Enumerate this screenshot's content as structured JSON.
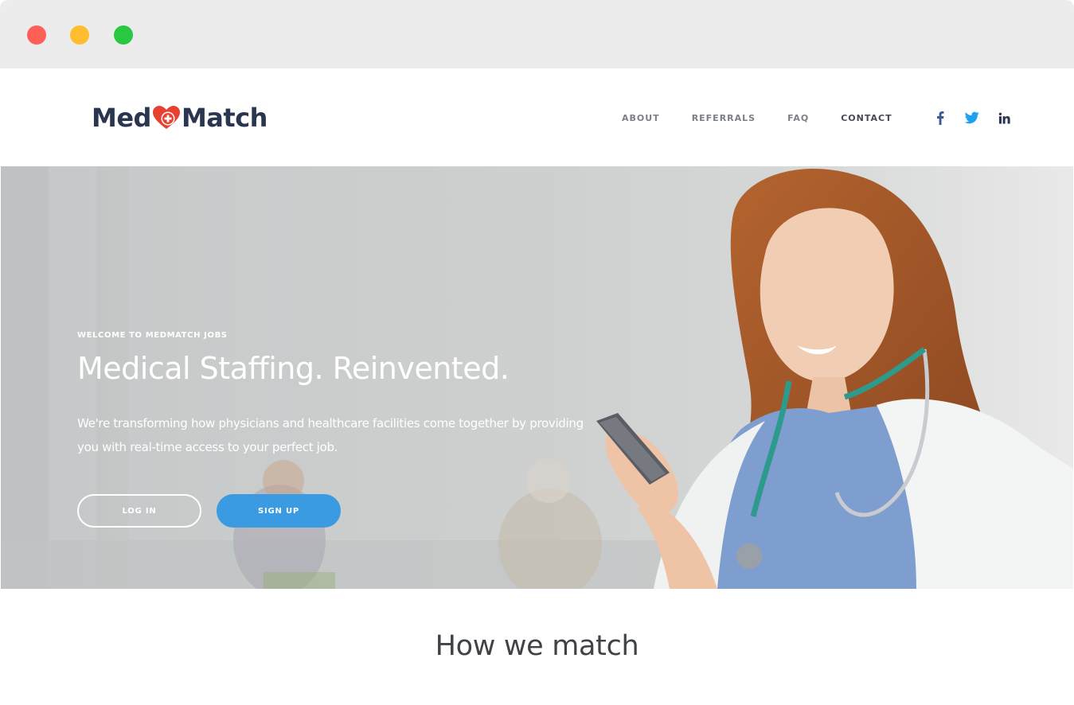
{
  "window": {
    "controls": [
      "close",
      "minimize",
      "maximize"
    ]
  },
  "header": {
    "logo_left": "Med",
    "logo_right": "Match",
    "logo_color": "#2a3650",
    "logo_accent": "#e8412f",
    "nav": [
      {
        "label": "ABOUT"
      },
      {
        "label": "REFERRALS"
      },
      {
        "label": "FAQ"
      },
      {
        "label": "CONTACT"
      }
    ],
    "social": [
      {
        "icon": "facebook-icon",
        "color": "#3b5998"
      },
      {
        "icon": "twitter-icon",
        "color": "#1da1f2"
      },
      {
        "icon": "linkedin-icon",
        "color": "#2a3650"
      }
    ]
  },
  "hero": {
    "kicker": "WELCOME TO MEDMATCH JOBS",
    "title": "Medical Staffing. Reinvented.",
    "description_line1": "We're transforming how physicians and healthcare facilities come together by providing",
    "description_line2": "you with real-time access to your perfect job.",
    "login_label": "LOG IN",
    "signup_label": "SIGN UP",
    "accent": "#3a9ae2"
  },
  "section": {
    "title": "How we match"
  }
}
